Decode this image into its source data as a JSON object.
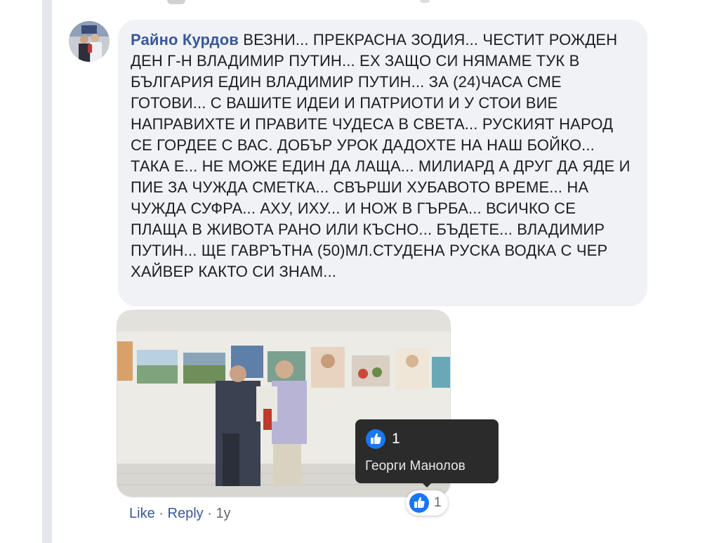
{
  "comment": {
    "author": "Райно Курдов",
    "text": "ВЕЗНИ... ПРЕКРАСНА ЗОДИЯ... ЧЕСТИТ РОЖДЕН ДЕН Г-Н ВЛАДИМИР ПУТИН... ЕХ ЗАЩО СИ НЯМАМЕ ТУК В БЪЛГАРИЯ ЕДИН ВЛАДИМИР ПУТИН... ЗА (24)ЧАСА СМЕ ГОТОВИ... С ВАШИТЕ ИДЕИ И ПАТРИОТИ И У СТОИ ВИЕ НАПРАВИХТЕ И ПРАВИТЕ ЧУДЕСА В СВЕТА... РУСКИЯТ НАРОД СЕ ГОРДЕЕ С ВАС. ДОБЪР УРОК ДАДОХТЕ НА НАШ БОЙКО... ТАКА Е... НЕ МОЖЕ ЕДИН ДА ЛАЩА... МИЛИАРД А ДРУГ ДА ЯДЕ И ПИЕ ЗА ЧУЖДА СМЕТКА... СВЪРШИ ХУБАВОТО ВРЕМЕ... НА ЧУЖДА СУФРА... АХУ, ИХУ... И НОЖ В ГЪРБА... ВСИЧКО СЕ ПЛАЩА В ЖИВОТА РАНО ИЛИ КЪСНО... БЪДЕТЕ... ВЛАДИМИР ПУТИН... ЩЕ ГАВРЪТНА (50)МЛ.СТУДЕНА РУСКА ВОДКА С ЧЕР ХАЙВЕР КАКТО СИ ЗНАМ..."
  },
  "tooltip": {
    "count": "1",
    "reactor": "Георги Манолов"
  },
  "reactions": {
    "icon": "like-icon",
    "count": "1"
  },
  "actions": {
    "like": "Like",
    "reply": "Reply",
    "time": "1y",
    "separator": "·"
  },
  "colors": {
    "author_link": "#385898",
    "bubble_bg": "#f0f2f5",
    "like_blue": "#1877f2",
    "tooltip_bg": "#2b2b2b"
  }
}
